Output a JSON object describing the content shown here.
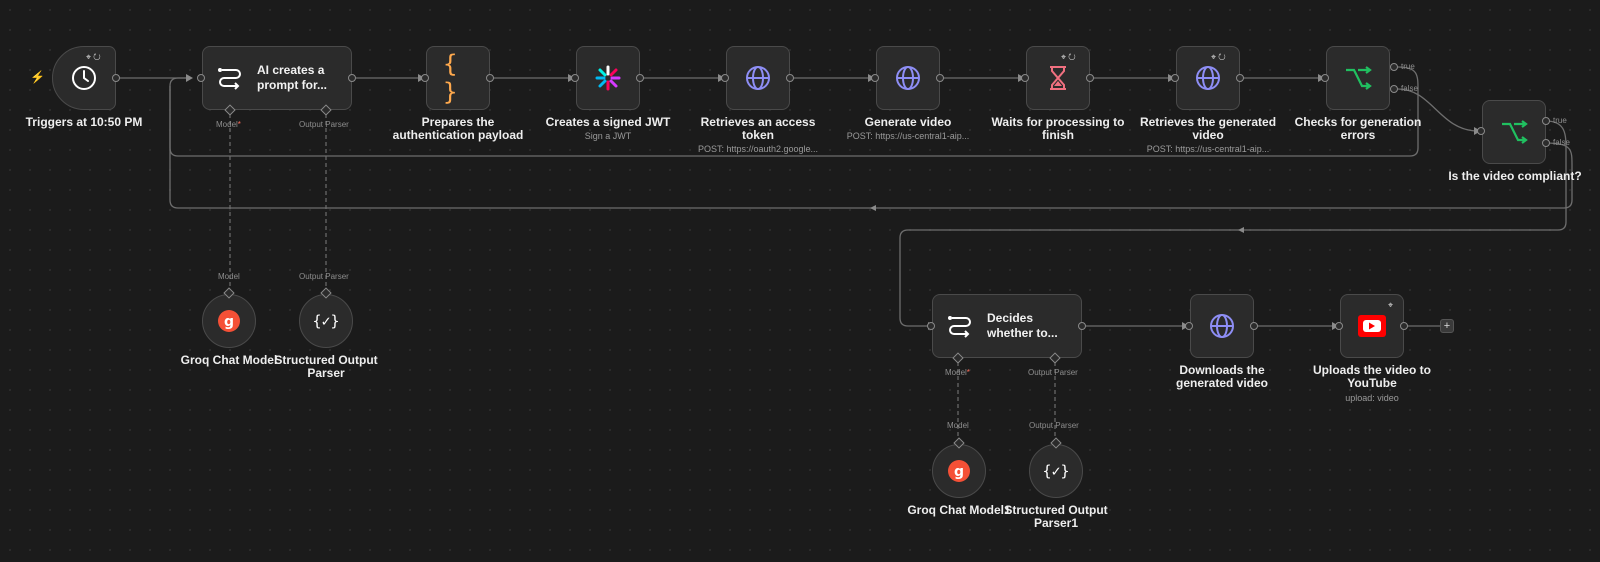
{
  "workflow": {
    "nodes": [
      {
        "id": "trigger",
        "label": "Triggers at 10:50 PM",
        "icon": "clock-icon"
      },
      {
        "id": "ai_prompt",
        "title": "AI creates a prompt for...",
        "icon": "ai-agent-icon",
        "ports": {
          "model": "Model",
          "model_req": "*",
          "parser": "Output Parser"
        }
      },
      {
        "id": "prep",
        "label": "Prepares the authentication payload",
        "icon": "code-braces-icon"
      },
      {
        "id": "jwt",
        "label": "Creates a signed JWT",
        "sub": "Sign a JWT",
        "icon": "jwt-icon"
      },
      {
        "id": "token",
        "label": "Retrieves an access token",
        "sub": "POST: https://oauth2.google...",
        "icon": "globe-icon"
      },
      {
        "id": "gen",
        "label": "Generate video",
        "sub": "POST: https://us-central1-aip...",
        "icon": "globe-icon"
      },
      {
        "id": "wait",
        "label": "Waits for processing to finish",
        "icon": "hourglass-icon"
      },
      {
        "id": "retrieve",
        "label": "Retrieves the generated video",
        "sub": "POST: https://us-central1-aip...",
        "icon": "globe-icon"
      },
      {
        "id": "checks",
        "label": "Checks for generation errors",
        "icon": "if-branch-icon",
        "outputs": [
          "true",
          "false"
        ]
      },
      {
        "id": "compliant",
        "label": "Is the video compliant?",
        "icon": "if-branch-icon",
        "outputs": [
          "true",
          "false"
        ]
      },
      {
        "id": "decides",
        "title": "Decides whether to...",
        "icon": "ai-agent-icon",
        "ports": {
          "model": "Model",
          "model_req": "*",
          "parser": "Output Parser"
        }
      },
      {
        "id": "download",
        "label": "Downloads the generated video",
        "icon": "globe-icon"
      },
      {
        "id": "youtube",
        "label": "Uploads the video to YouTube",
        "sub": "upload: video",
        "icon": "youtube-icon"
      },
      {
        "id": "groq1",
        "label": "Groq Chat Model",
        "icon": "groq-icon",
        "port": "Model"
      },
      {
        "id": "parser1",
        "label": "Structured Output Parser",
        "icon": "structured-parser-icon",
        "port": "Output Parser"
      },
      {
        "id": "groq2",
        "label": "Groq Chat Model1",
        "icon": "groq-icon",
        "port": "Model"
      },
      {
        "id": "parser2",
        "label": "Structured Output Parser1",
        "icon": "structured-parser-icon",
        "port": "Output Parser"
      }
    ],
    "add_button": "+",
    "colors": {
      "background": "#1b1b1b",
      "node_fill": "#2b2b2b",
      "node_border": "#4a4a4a",
      "wire": "#6e6e6e",
      "brace_orange": "#ffa94d",
      "globe_purple": "#8e8ef5",
      "hourglass_pink": "#f07080",
      "branch_green": "#20c060",
      "groq_red": "#f55036",
      "youtube_red": "#ff0000",
      "trigger_orange": "#ff6d2a"
    }
  }
}
